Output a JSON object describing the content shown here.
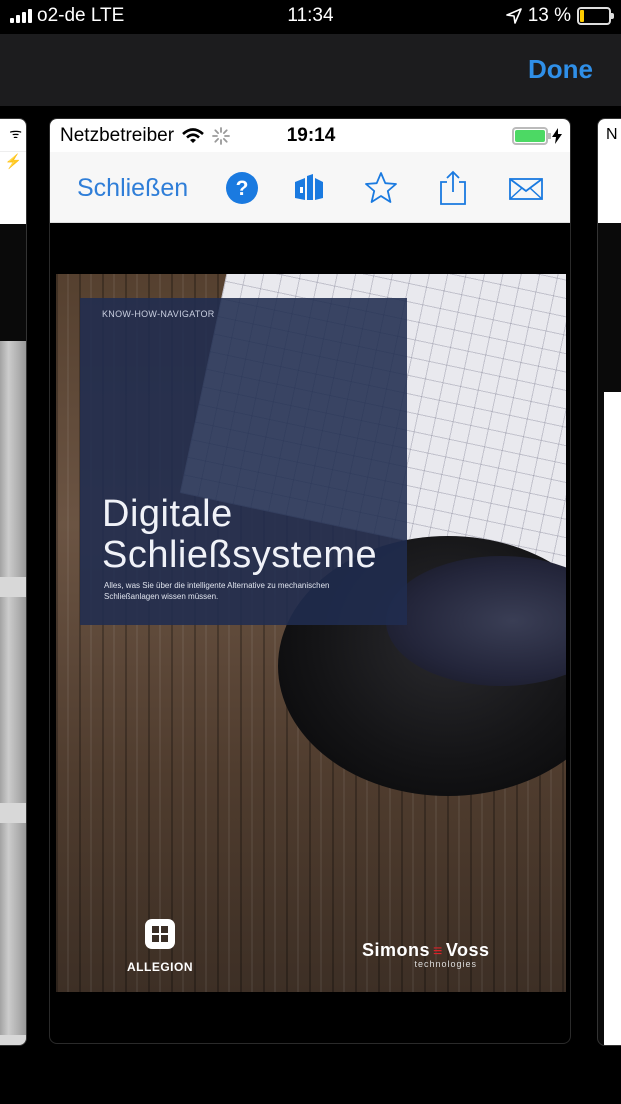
{
  "outer_status": {
    "carrier": "o2-de LTE",
    "time": "11:34",
    "battery": "13 %"
  },
  "nav": {
    "done_label": "Done"
  },
  "left_card": {
    "status_fragment": "ᯤ ⚡"
  },
  "right_card": {
    "status_fragment": "N"
  },
  "inner_status": {
    "carrier": "Netzbetreiber",
    "time": "19:14"
  },
  "toolbar": {
    "close_label": "Schließen",
    "icons": [
      "help-icon",
      "library-icon",
      "favorite-star-icon",
      "share-icon",
      "mail-icon"
    ]
  },
  "cover": {
    "kicker": "KNOW-HOW-NAVIGATOR",
    "title_line1": "Digitale",
    "title_line2": "Schließsysteme",
    "subtitle": "Alles, was Sie über die intelligente Alternative zu mechanischen Schließanlagen wissen müssen.",
    "brand_left": "ALLEGION",
    "brand_right_name_a": "Simons",
    "brand_right_name_b": "Voss",
    "brand_right_tagline": "technologies"
  },
  "colors": {
    "accent": "#2f8fe8",
    "panel": "#202c50",
    "battery_low": "#ffcc00",
    "battery_full": "#4cd964"
  }
}
